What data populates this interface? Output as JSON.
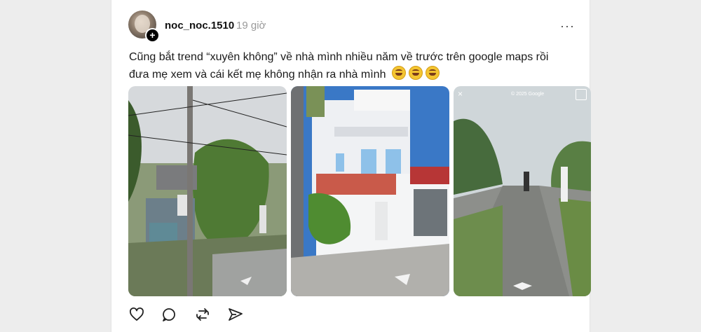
{
  "post": {
    "username": "noc_noc.1510",
    "time": "19 giờ",
    "caption_line1": "Cũng bắt trend “xuyên không” về nhà mình nhiều năm về trước trên google maps rồi",
    "caption_line2": "đưa mẹ xem và cái kết mẹ không nhận ra nhà mình",
    "more_label": "···",
    "photos": [
      {
        "overlay": ""
      },
      {
        "overlay": ""
      },
      {
        "overlay": "© 2025 Google"
      }
    ]
  },
  "icons": [
    "heart-icon",
    "comment-icon",
    "repost-icon",
    "share-icon"
  ],
  "colors": {
    "background": "#ededed",
    "card": "#ffffff",
    "text": "#111111",
    "muted": "#9a9a9a"
  }
}
